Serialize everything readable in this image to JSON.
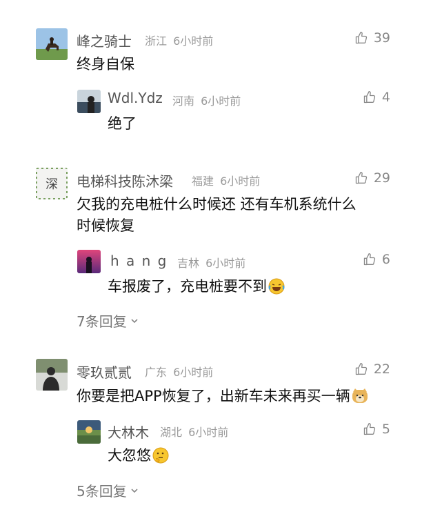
{
  "comments": [
    {
      "username": "峰之骑士",
      "location": "浙江",
      "time": "6小时前",
      "likes": "39",
      "text": "终身自保",
      "reply": {
        "username": "Wdl.Ydz",
        "location": "河南",
        "time": "6小时前",
        "likes": "4",
        "text": "绝了"
      }
    },
    {
      "username": "电梯科技陈沐梁",
      "location": "福建",
      "time": "6小时前",
      "likes": "29",
      "text_line1": "欠我的充电桩什么时候还  还有车机系统什么",
      "text_line2": "时候恢复",
      "avatar_text": "深",
      "reply": {
        "username": "h a n g",
        "location": "吉林",
        "time": "6小时前",
        "likes": "6",
        "text": "车报废了，充电桩要不到"
      },
      "more_replies": "7条回复"
    },
    {
      "username": "零玖贰贰",
      "location": "广东",
      "time": "6小时前",
      "likes": "22",
      "text": "你要是把APP恢复了，出新车未来再买一辆",
      "reply": {
        "username": "大林木",
        "location": "湖北",
        "time": "6小时前",
        "likes": "5",
        "text": "大忽悠"
      },
      "more_replies": "5条回复"
    }
  ]
}
